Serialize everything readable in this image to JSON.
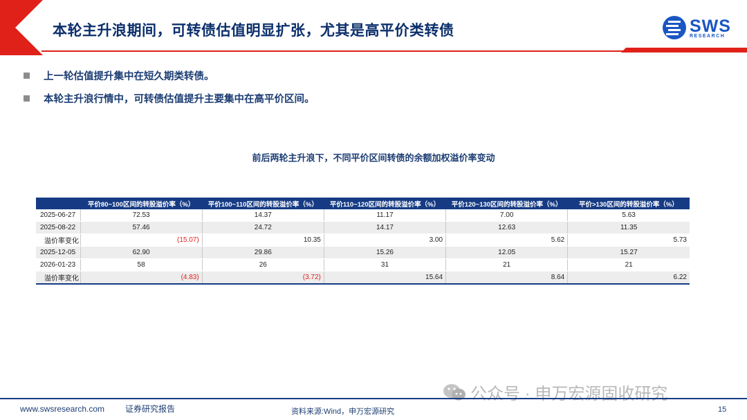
{
  "header": {
    "title": "本轮主升浪期间，可转债估值明显扩张，尤其是高平价类转债",
    "logo_text": "SWS",
    "logo_sub": "RESEARCH"
  },
  "bullets": [
    "上一轮估值提升集中在短久期类转债。",
    "本轮主升浪行情中，可转债估值提升主要集中在高平价区间。"
  ],
  "table_title": "前后两轮主升浪下，不同平价区间转债的余额加权溢价率变动",
  "table": {
    "columns": [
      "平价80~100区间的转股溢价率（%）",
      "平价100~110区间的转股溢价率（%）",
      "平价110~120区间的转股溢价率（%）",
      "平价120~130区间的转股溢价率（%）",
      "平价>130区间的转股溢价率（%）"
    ],
    "rows": [
      {
        "label": "2025-06-27",
        "values": [
          "72.53",
          "14.37",
          "11.17",
          "7.00",
          "5.63"
        ]
      },
      {
        "label": "2025-08-22",
        "values": [
          "57.46",
          "24.72",
          "14.17",
          "12.63",
          "11.35"
        ]
      },
      {
        "label": "溢价率变化",
        "values": [
          "(15.07)",
          "10.35",
          "3.00",
          "5.62",
          "5.73"
        ]
      },
      {
        "label": "2025-12-05",
        "values": [
          "62.90",
          "29.86",
          "15.26",
          "12.05",
          "15.27"
        ]
      },
      {
        "label": "2026-01-23",
        "values": [
          "58",
          "26",
          "31",
          "21",
          "21"
        ]
      },
      {
        "label": "溢价率变化",
        "values": [
          "(4.83)",
          "(3.72)",
          "15.64",
          "8.64",
          "6.22"
        ]
      }
    ]
  },
  "footer": {
    "url": "www.swsresearch.com",
    "report_type": "证券研究报告",
    "source": "资料来源:Wind，申万宏源研究",
    "page": "15"
  },
  "watermark": "公众号 · 申万宏源固收研究",
  "colors": {
    "navy": "#163b84",
    "red_accent": "#e0211a",
    "logo_blue": "#1a56c4"
  }
}
